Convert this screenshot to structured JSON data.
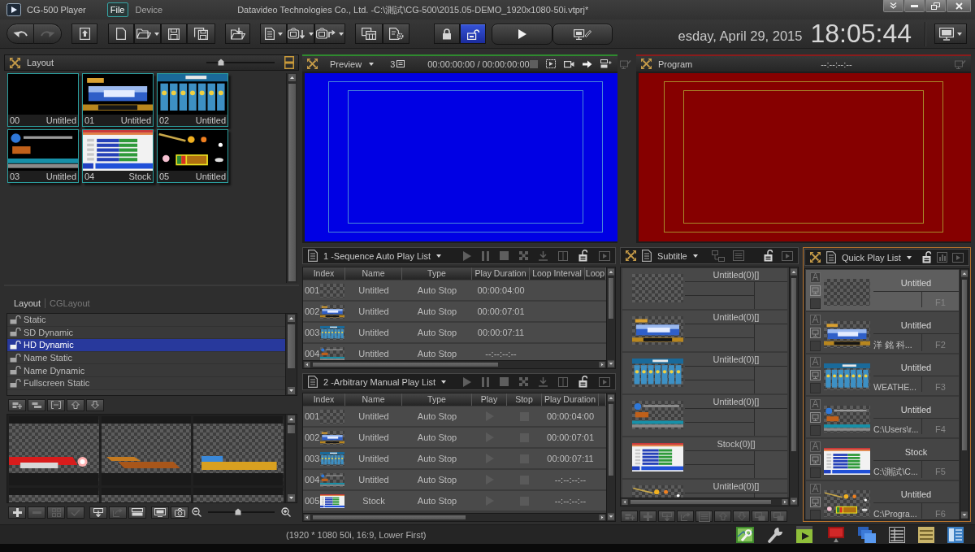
{
  "window": {
    "app_name": "CG-500 Player",
    "title": "Datavideo Technologies Co., Ltd. -C:\\測試\\CG-500\\2015.05-DEMO_1920x1080-50i.vtprj*"
  },
  "menu": [
    {
      "label": "File",
      "selected": true
    },
    {
      "label": "Device",
      "selected": false
    }
  ],
  "toolbar": {
    "lock_modes": [
      {
        "kind": "locked",
        "selected": false
      },
      {
        "kind": "unlocked",
        "selected": true
      }
    ]
  },
  "clock": {
    "date": "esday, April 29, 2015",
    "time": "18:05:44"
  },
  "layout_panel": {
    "title": "Layout",
    "zoom": {
      "level": 0.22
    },
    "tiles": [
      {
        "index": "00",
        "name": "Untitled",
        "kind": "blank"
      },
      {
        "index": "01",
        "name": "Untitled",
        "kind": "banner"
      },
      {
        "index": "02",
        "name": "Untitled",
        "kind": "weather"
      },
      {
        "index": "03",
        "name": "Untitled",
        "kind": "logo"
      },
      {
        "index": "04",
        "name": "Stock",
        "kind": "stock"
      },
      {
        "index": "05",
        "name": "Untitled",
        "kind": "effects"
      }
    ]
  },
  "layout_tabs": [
    {
      "label": "Layout",
      "selected": true
    },
    {
      "label": "CGLayout",
      "selected": false
    }
  ],
  "layout_list": [
    {
      "label": "Static",
      "selected": false
    },
    {
      "label": "SD Dynamic",
      "selected": false
    },
    {
      "label": "HD Dynamic",
      "selected": true
    },
    {
      "label": "Name Static",
      "selected": false
    },
    {
      "label": "Name Dynamic",
      "selected": false
    },
    {
      "label": "Fullscreen Static",
      "selected": false
    }
  ],
  "templates": {
    "items": [
      {
        "kind": "flare"
      },
      {
        "kind": "streak"
      },
      {
        "kind": "banner"
      },
      {
        "kind": "blank"
      },
      {
        "kind": "blank"
      },
      {
        "kind": "blank"
      }
    ],
    "zoom": {
      "level": 0.45
    }
  },
  "preview": {
    "title": "Preview",
    "layer_count": "3",
    "timecode": "00:00:00:00 / 00:00:00:00"
  },
  "program": {
    "title": "Program",
    "timecode": "--:--:--:--"
  },
  "sequence_playlist": {
    "title": "1 -Sequence Auto Play List",
    "columns": [
      "Index",
      "Name",
      "Type",
      "Play Duration",
      "Loop Interval",
      "Loop"
    ],
    "rows": [
      {
        "index": "001",
        "kind": "blank",
        "name": "Untitled",
        "type": "Auto Stop",
        "duration": "00:00:04:00"
      },
      {
        "index": "002",
        "kind": "banner",
        "name": "Untitled",
        "type": "Auto Stop",
        "duration": "00:00:07:01"
      },
      {
        "index": "003",
        "kind": "weather",
        "name": "Untitled",
        "type": "Auto Stop",
        "duration": "00:00:07:11"
      },
      {
        "index": "004",
        "kind": "logo",
        "name": "Untitled",
        "type": "Auto Stop",
        "duration": "--:--:--:--"
      }
    ]
  },
  "manual_playlist": {
    "title": "2 -Arbitrary Manual Play List",
    "columns": [
      "Index",
      "Name",
      "Type",
      "Play",
      "Stop",
      "Play Duration"
    ],
    "rows": [
      {
        "index": "001",
        "kind": "blank",
        "name": "Untitled",
        "type": "Auto Stop",
        "duration": "00:00:04:00"
      },
      {
        "index": "002",
        "kind": "banner",
        "name": "Untitled",
        "type": "Auto Stop",
        "duration": "00:00:07:01"
      },
      {
        "index": "003",
        "kind": "weather",
        "name": "Untitled",
        "type": "Auto Stop",
        "duration": "00:00:07:11"
      },
      {
        "index": "004",
        "kind": "logo",
        "name": "Untitled",
        "type": "Auto Stop",
        "duration": "--:--:--:--"
      },
      {
        "index": "005",
        "kind": "stock",
        "name": "Stock",
        "type": "Auto Stop",
        "duration": "--:--:--:--"
      }
    ]
  },
  "subtitle": {
    "title": "Subtitle",
    "items": [
      {
        "label": "Untitled(0)[]",
        "kind": "blank"
      },
      {
        "label": "Untitled(0)[]",
        "kind": "banner"
      },
      {
        "label": "Untitled(0)[]",
        "kind": "weather"
      },
      {
        "label": "Untitled(0)[]",
        "kind": "logo"
      },
      {
        "label": "Stock(0)[]",
        "kind": "stock"
      },
      {
        "label": "Untitled(0)[]",
        "kind": "effects"
      }
    ]
  },
  "quick_play": {
    "title": "Quick Play List",
    "items": [
      {
        "toggle": "A",
        "name": "Untitled",
        "key": "F1",
        "kind": "blank",
        "selected": true,
        "checked": false
      },
      {
        "toggle": "A",
        "name": "Untitled",
        "detail": "洋 銘 科...",
        "key": "F2",
        "kind": "banner",
        "selected": false,
        "checked": false
      },
      {
        "toggle": "A",
        "name": "Untitled",
        "detail": "WEATHE...",
        "key": "F3",
        "kind": "weather",
        "selected": false,
        "checked": false
      },
      {
        "toggle": "A",
        "name": "Untitled",
        "detail": "C:\\Users\\r...",
        "key": "F4",
        "kind": "logo",
        "selected": false,
        "checked": false
      },
      {
        "toggle": "A",
        "name": "Stock",
        "detail": "C:\\測試\\C...",
        "key": "F5",
        "kind": "stock",
        "selected": false,
        "checked": false
      },
      {
        "toggle": "A",
        "name": "Untitled",
        "detail": "C:\\Progra...",
        "key": "F6",
        "kind": "effects",
        "selected": false,
        "checked": false
      }
    ]
  },
  "status_bar": {
    "text": "(1920 * 1080 50i, 16:9, Lower First)"
  }
}
